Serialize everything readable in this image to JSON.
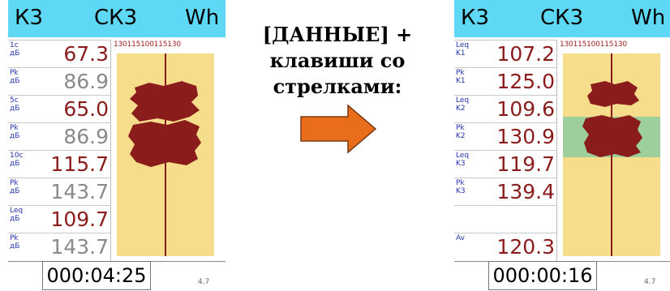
{
  "left": {
    "header": {
      "k3": "К3",
      "sk3": "СК3",
      "wh": "Wh"
    },
    "scale_label": "130115100115130",
    "rows": [
      {
        "label1": "1c",
        "label2": "дБ",
        "value": "67.3",
        "tone": "dark"
      },
      {
        "label1": "Pk",
        "label2": "дБ",
        "value": "86.9",
        "tone": "grey"
      },
      {
        "label1": "5c",
        "label2": "дБ",
        "value": "65.0",
        "tone": "dark"
      },
      {
        "label1": "Pk",
        "label2": "дБ",
        "value": "86.9",
        "tone": "grey"
      },
      {
        "label1": "10c",
        "label2": "дБ",
        "value": "115.7",
        "tone": "dark"
      },
      {
        "label1": "Pk",
        "label2": "дБ",
        "value": "143.7",
        "tone": "grey"
      },
      {
        "label1": "Leq",
        "label2": "дБ",
        "value": "109.7",
        "tone": "dark"
      },
      {
        "label1": "Pk",
        "label2": "дБ",
        "value": "143.7",
        "tone": "grey"
      }
    ],
    "timer": "000:04:25",
    "small_value": "4.7"
  },
  "middle": {
    "line1": "[ДАННЫЕ] +",
    "line2": "клавиши со",
    "line3": "стрелками:",
    "arrow_color": "#e96d1a"
  },
  "right": {
    "header": {
      "k3": "К3",
      "sk3": "СК3",
      "wh": "Wh"
    },
    "scale_label": "130115100115130",
    "rows": [
      {
        "label1": "Leq",
        "label2": "K1",
        "value": "107.2",
        "tone": "dark"
      },
      {
        "label1": "Pk",
        "label2": "K1",
        "value": "125.0",
        "tone": "dark"
      },
      {
        "label1": "Leq",
        "label2": "K2",
        "value": "109.6",
        "tone": "dark"
      },
      {
        "label1": "Pk",
        "label2": "K2",
        "value": "130.9",
        "tone": "dark"
      },
      {
        "label1": "Leq",
        "label2": "K3",
        "value": "119.7",
        "tone": "dark"
      },
      {
        "label1": "Pk",
        "label2": "K3",
        "value": "139.4",
        "tone": "dark"
      }
    ],
    "av_label": "Av",
    "av_value": "120.3",
    "timer": "000:00:16",
    "small_value": "4.7"
  },
  "colors": {
    "header_bg": "#5fd8f5",
    "panel_bg": "#f5dd8c",
    "highlight": "#9ccf9c",
    "wave": "#8b1c1c"
  }
}
